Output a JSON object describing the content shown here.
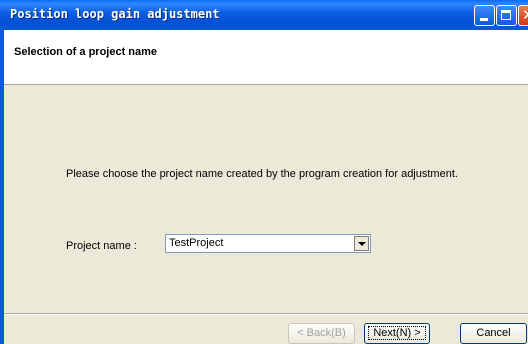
{
  "window": {
    "title": "Position loop gain adjustment"
  },
  "header": {
    "title": "Selection of a project name"
  },
  "main": {
    "prompt": "Please choose the project name created by the program creation for adjustment.",
    "project_label": "Project name :",
    "project_value": "TestProject"
  },
  "buttons": {
    "back": "< Back(B)",
    "next": "Next(N) >",
    "cancel": "Cancel"
  }
}
